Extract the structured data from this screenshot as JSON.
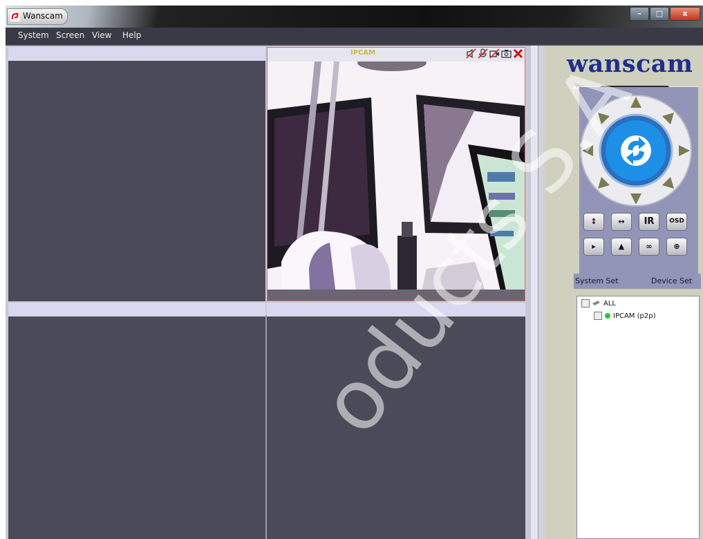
{
  "window": {
    "title": "Wanscam",
    "controls": {
      "minimize": "–",
      "maximize": "□",
      "close": "x"
    }
  },
  "menu": [
    "System",
    "Screen",
    "View",
    "Help"
  ],
  "video": {
    "active_camera_label": "IPCAM",
    "camera_toolbar_icons": [
      "mute-audio-icon",
      "talk-icon",
      "record-icon",
      "snapshot-icon",
      "close-icon"
    ]
  },
  "brand": {
    "logo": "wanscam"
  },
  "ptz": {
    "center_icon": "refresh-icon",
    "buttons": [
      {
        "label": "↕",
        "icon": "vertical-patrol-icon"
      },
      {
        "label": "↔",
        "icon": "horizontal-patrol-icon"
      },
      {
        "label": "IR",
        "icon": "ir-icon"
      },
      {
        "label": "OSD",
        "icon": "osd-icon"
      },
      {
        "label": "▸",
        "icon": "flip-icon"
      },
      {
        "label": "▲",
        "icon": "mirror-icon"
      },
      {
        "label": "∞",
        "icon": "cruise-icon"
      },
      {
        "label": "⊕",
        "icon": "center-icon"
      }
    ]
  },
  "side_links": {
    "system_set": "System Set",
    "device_set": "Device Set"
  },
  "device_tree": {
    "root": "ALL",
    "devices": [
      {
        "name": "IPCAM (p2p)",
        "status_color": "#22cc22"
      }
    ]
  },
  "watermark": "oducts S.A",
  "colors": {
    "logo": "#1e2f8c",
    "pane_bg": "#4a4a58",
    "ptz_blue": "#1e8fe6"
  }
}
